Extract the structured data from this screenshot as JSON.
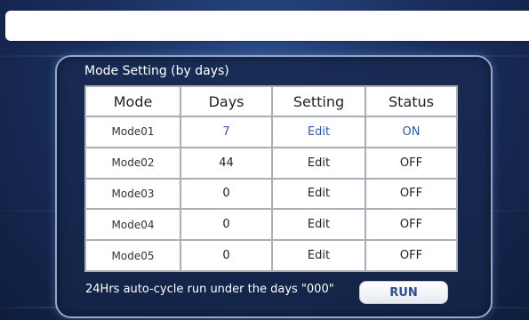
{
  "panel": {
    "title": "Mode Setting (by days)"
  },
  "table": {
    "headers": [
      "Mode",
      "Days",
      "Setting",
      "Status"
    ],
    "rows": [
      {
        "mode": "Mode01",
        "days": "7",
        "setting": "Edit",
        "status": "ON"
      },
      {
        "mode": "Mode02",
        "days": "44",
        "setting": "Edit",
        "status": "OFF"
      },
      {
        "mode": "Mode03",
        "days": "0",
        "setting": "Edit",
        "status": "OFF"
      },
      {
        "mode": "Mode04",
        "days": "0",
        "setting": "Edit",
        "status": "OFF"
      },
      {
        "mode": "Mode05",
        "days": "0",
        "setting": "Edit",
        "status": "OFF"
      }
    ]
  },
  "footer": {
    "note": "24Hrs auto-cycle run under the days \"000\"",
    "run_label": "RUN"
  },
  "colors": {
    "background": "#1a2f5e",
    "panel_border": "#8fa7c8",
    "active_text": "#2e5aa8",
    "run_text": "#2c4d8e"
  }
}
